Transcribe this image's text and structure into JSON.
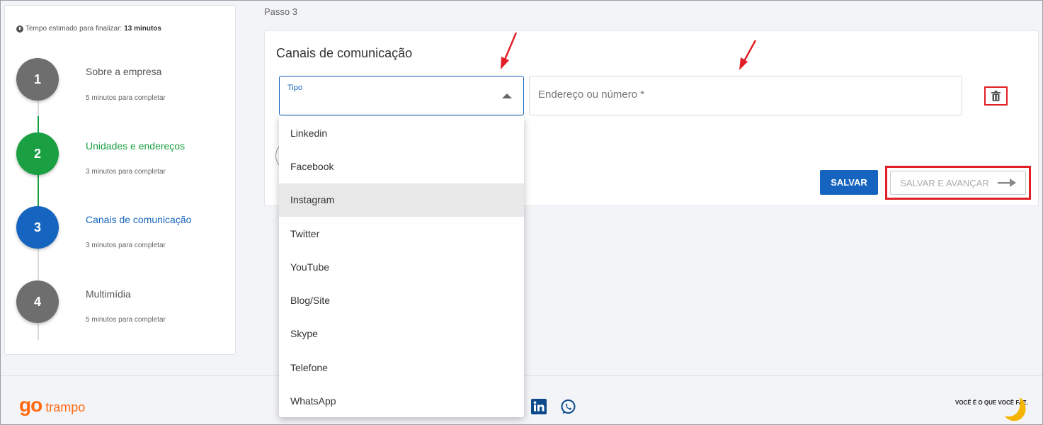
{
  "sidebar": {
    "eta_prefix": "Tempo estimado para finalizar:",
    "eta_value": "13 minutos",
    "steps": [
      {
        "number": "1",
        "title": "Sobre a empresa",
        "subtitle": "5 minutos para completar"
      },
      {
        "number": "2",
        "title": "Unidades e endereços",
        "subtitle": "3 minutos para completar"
      },
      {
        "number": "3",
        "title": "Canais de comunicação",
        "subtitle": "3 minutos para completar"
      },
      {
        "number": "4",
        "title": "Multimídia",
        "subtitle": "5 minutos para completar"
      }
    ]
  },
  "main": {
    "step_label": "Passo 3",
    "card_title": "Canais de comunicação",
    "type_label": "Tipo",
    "address_placeholder": "Endereço ou número *",
    "save_label": "SALVAR",
    "save_advance_label": "SALVAR E AVANÇAR"
  },
  "dropdown": {
    "options": [
      "Linkedin",
      "Facebook",
      "Instagram",
      "Twitter",
      "YouTube",
      "Blog/Site",
      "Skype",
      "Telefone",
      "WhatsApp"
    ],
    "highlighted": "Instagram"
  },
  "footer": {
    "logo_go": "go",
    "logo_trampo": "trampo",
    "tagline": "VOCÊ É O QUE VOCÊ FAZ."
  },
  "colors": {
    "primary": "#1565c0",
    "success": "#1aa043",
    "muted_step": "#6e6e6e",
    "annotation": "#e01f26",
    "brand_orange": "#ff6a13"
  },
  "icons": {
    "clock": "clock-icon",
    "caret": "caret-up-icon",
    "trash": "trash-icon",
    "arrow_right": "arrow-right-icon",
    "linkedin": "linkedin-icon",
    "whatsapp": "whatsapp-icon"
  }
}
